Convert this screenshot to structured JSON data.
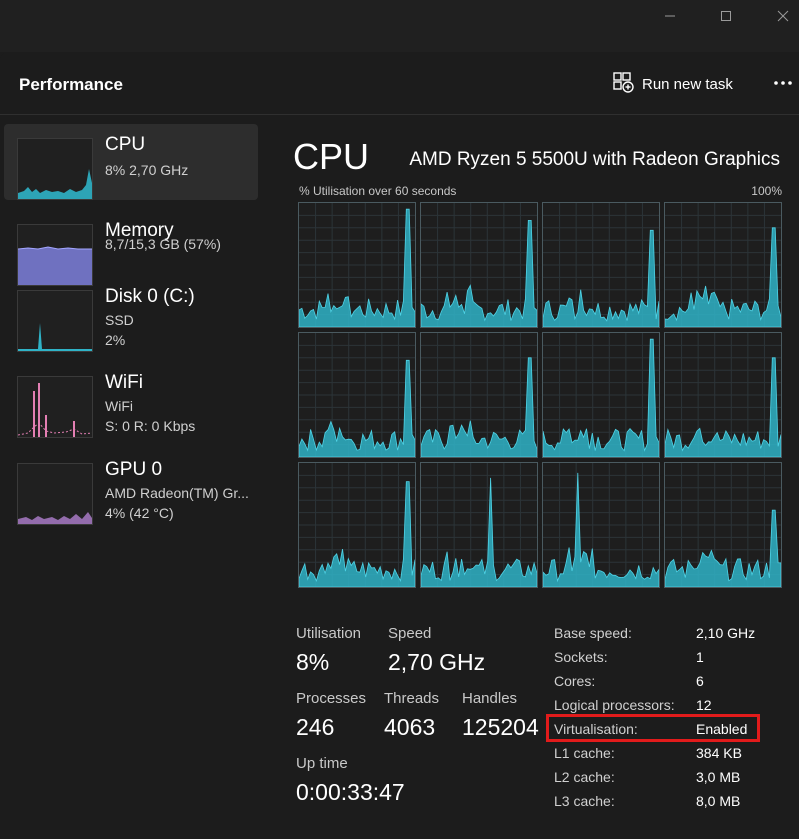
{
  "window": {
    "min_icon": "minimize-icon",
    "max_icon": "maximize-icon",
    "close_icon": "close-icon"
  },
  "header": {
    "title": "Performance",
    "run_task_label": "Run new task",
    "run_task_icon": "run-task-icon",
    "more_icon": "more-icon"
  },
  "sidebar": {
    "items": [
      {
        "name": "CPU",
        "sub1": "8%  2,70 GHz",
        "sub2": "",
        "color": "#2fb3c7",
        "selected": true
      },
      {
        "name": "Memory",
        "sub1": "8,7/15,3 GB (57%)",
        "sub2": "",
        "color": "#8b8ee8"
      },
      {
        "name": "Disk 0 (C:)",
        "sub1": "SSD",
        "sub2": "2%",
        "color": "#2fb3c7"
      },
      {
        "name": "WiFi",
        "sub1": "WiFi",
        "sub2": "S: 0 R: 0 Kbps",
        "color": "#e37fb3"
      },
      {
        "name": "GPU 0",
        "sub1": "AMD Radeon(TM) Gr...",
        "sub2": "4% (42 °C)",
        "color": "#b07fd0"
      }
    ]
  },
  "main": {
    "title": "CPU",
    "model": "AMD Ryzen 5 5500U with Radeon Graphics",
    "util_label": "% Utilisation over 60 seconds",
    "max_label": "100%",
    "accent": "#2fb3c7",
    "stats": {
      "utilisation_label": "Utilisation",
      "utilisation": "8%",
      "speed_label": "Speed",
      "speed": "2,70 GHz",
      "processes_label": "Processes",
      "processes": "246",
      "threads_label": "Threads",
      "threads": "4063",
      "handles_label": "Handles",
      "handles": "125204",
      "uptime_label": "Up time",
      "uptime": "0:00:33:47"
    },
    "specs": [
      {
        "label": "Base speed:",
        "value": "2,10 GHz"
      },
      {
        "label": "Sockets:",
        "value": "1"
      },
      {
        "label": "Cores:",
        "value": "6"
      },
      {
        "label": "Logical processors:",
        "value": "12"
      },
      {
        "label": "Virtualisation:",
        "value": "Enabled"
      },
      {
        "label": "L1 cache:",
        "value": "384 KB"
      },
      {
        "label": "L2 cache:",
        "value": "3,0 MB"
      },
      {
        "label": "L3 cache:",
        "value": "8,0 MB"
      }
    ],
    "highlight_color": "#e21b1b"
  }
}
